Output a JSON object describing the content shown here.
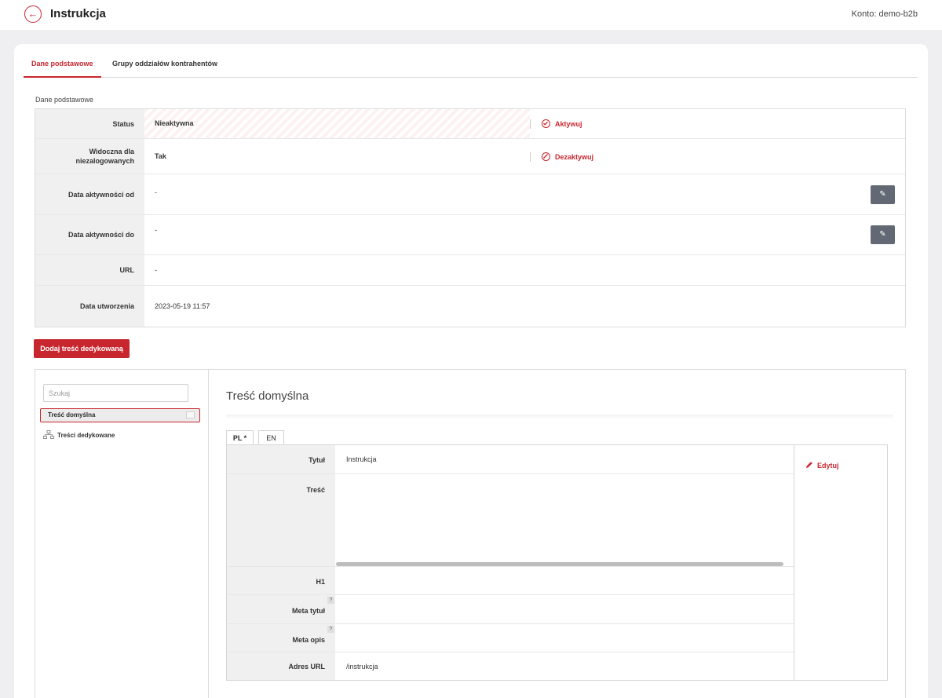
{
  "header": {
    "title": "Instrukcja",
    "account": "Konto: demo-b2b"
  },
  "tabs": [
    {
      "label": "Dane podstawowe",
      "active": true
    },
    {
      "label": "Grupy oddziałów kontrahentów",
      "active": false
    }
  ],
  "basic": {
    "section_label": "Dane podstawowe",
    "rows": {
      "status": {
        "label": "Status",
        "value": "Nieaktywna",
        "action": "Aktywuj"
      },
      "visible": {
        "label": "Widoczna dla niezalogowanych",
        "value": "Tak",
        "action": "Dezaktywuj"
      },
      "date_from": {
        "label": "Data aktywności od",
        "value": "-"
      },
      "date_to": {
        "label": "Data aktywności do",
        "value": "-"
      },
      "url": {
        "label": "URL",
        "value": "-"
      },
      "created": {
        "label": "Data utworzenia",
        "value": "2023-05-19 11:57"
      }
    }
  },
  "add_button": "Dodaj treść dedykowaną",
  "tree": {
    "search_placeholder": "Szukaj",
    "selected": "Treść domyślna",
    "item": "Treści dedykowane"
  },
  "content": {
    "title": "Treść domyślna",
    "lang_tabs": [
      "PL *",
      "EN"
    ],
    "rows": {
      "title": {
        "label": "Tytuł",
        "value": "Instrukcja"
      },
      "body": {
        "label": "Treść",
        "value": ""
      },
      "h1": {
        "label": "H1",
        "value": ""
      },
      "meta_title": {
        "label": "Meta tytuł",
        "value": "",
        "help": "?"
      },
      "meta_desc": {
        "label": "Meta opis",
        "value": "",
        "help": "?"
      },
      "url": {
        "label": "Adres URL",
        "value": "/instrukcja"
      }
    },
    "edit": "Edytuj"
  },
  "colors": {
    "accent": "#c8262e",
    "edit_button": "#636974",
    "label_bg": "#f0f0f0"
  }
}
